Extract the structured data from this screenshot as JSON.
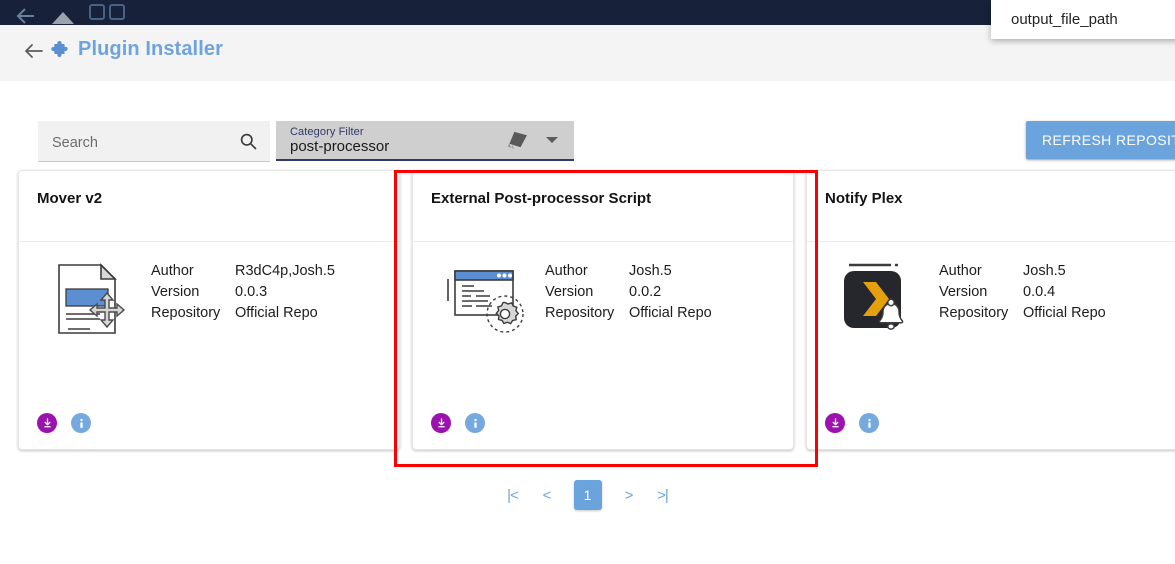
{
  "os_bar": {
    "back_icon": "back-arrow-icon",
    "home_icon": "home-triangle-icon",
    "tabs_icon": "tabs-icon"
  },
  "header": {
    "back_icon": "back-arrow-icon",
    "app_icon": "puzzle-piece-icon",
    "title": "Plugin Installer",
    "title_color": "#6ea3dd"
  },
  "tooltip": {
    "text": "output_file_path"
  },
  "search": {
    "placeholder": "Search",
    "value": "",
    "icon": "search-icon"
  },
  "category_filter": {
    "label": "Category Filter",
    "value": "post-processor",
    "icon": "category-layers-icon",
    "arrow_icon": "chevron-down-icon"
  },
  "refresh_button": {
    "label": "REFRESH REPOSITORIES",
    "color": "#6ba4dd"
  },
  "cards": [
    {
      "title": "Mover v2",
      "icon": "document-move-icon",
      "meta": [
        {
          "key": "Author",
          "value": "R3dC4p,Josh.5"
        },
        {
          "key": "Version",
          "value": "0.0.3"
        },
        {
          "key": "Repository",
          "value": "Official Repo"
        }
      ],
      "actions": {
        "download": "download-icon",
        "info": "info-icon"
      },
      "highlighted": false
    },
    {
      "title": "External Post-processor Script",
      "icon": "script-gear-icon",
      "meta": [
        {
          "key": "Author",
          "value": "Josh.5"
        },
        {
          "key": "Version",
          "value": "0.0.2"
        },
        {
          "key": "Repository",
          "value": "Official Repo"
        }
      ],
      "actions": {
        "download": "download-icon",
        "info": "info-icon"
      },
      "highlighted": true
    },
    {
      "title": "Notify Plex",
      "icon": "plex-bell-icon",
      "meta": [
        {
          "key": "Author",
          "value": "Josh.5"
        },
        {
          "key": "Version",
          "value": "0.0.4"
        },
        {
          "key": "Repository",
          "value": "Official Repo"
        }
      ],
      "actions": {
        "download": "download-icon",
        "info": "info-icon"
      },
      "highlighted": false
    }
  ],
  "pagination": {
    "first": "|<",
    "prev": "<",
    "current_page": "1",
    "next": ">",
    "last": ">|"
  },
  "colors": {
    "accent_blue": "#6ba4dd",
    "download_purple": "#9c12ae",
    "info_blue": "#76aade",
    "highlight_red": "#ff0000",
    "os_bar": "#18213a"
  }
}
